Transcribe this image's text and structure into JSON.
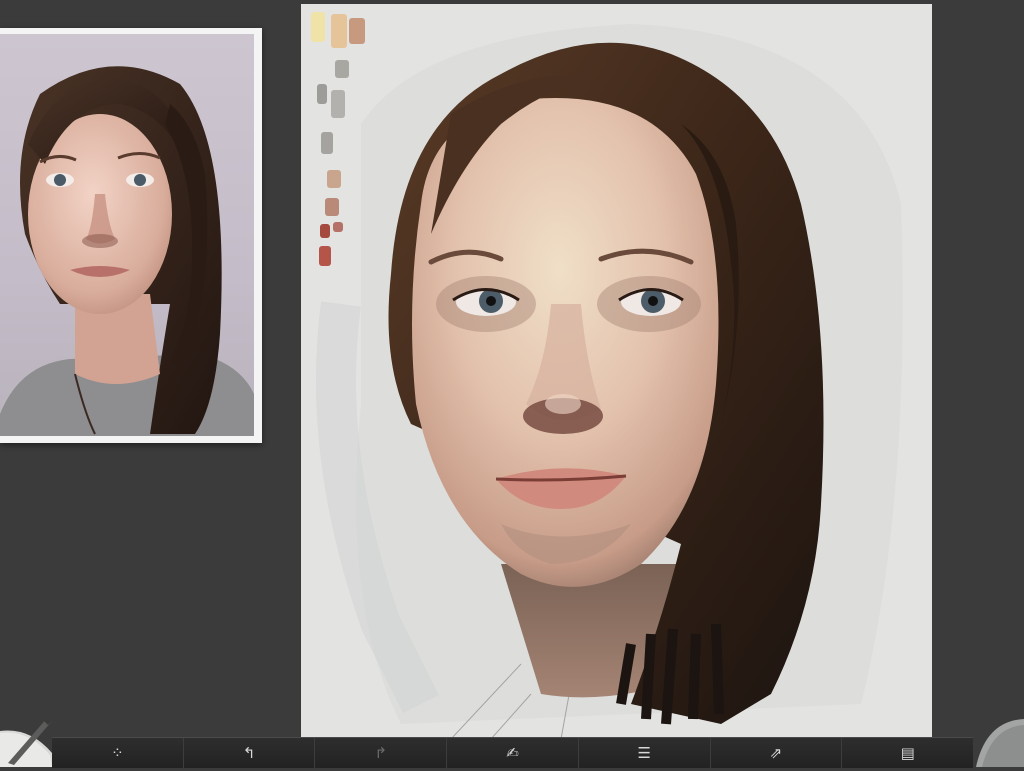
{
  "app": {
    "canvas_background": "#e3e3e1",
    "workspace_background": "#3b3b3b"
  },
  "palette": {
    "swatches": [
      "#efe3a8",
      "#e6c49a",
      "#c79a80",
      "#a9a7a2",
      "#9e9c98",
      "#b3b1ad",
      "#a5a3a0",
      "#c9a58e",
      "#b98a78",
      "#a54a3f",
      "#b57068",
      "#b5554a"
    ]
  },
  "toolbar": {
    "buttons": [
      {
        "name": "brush-settings-button",
        "icon": "dots-icon",
        "glyph": "⁘",
        "enabled": true
      },
      {
        "name": "undo-button",
        "icon": "undo-icon",
        "glyph": "↰",
        "enabled": true
      },
      {
        "name": "redo-button",
        "icon": "redo-icon",
        "glyph": "↱",
        "enabled": false
      },
      {
        "name": "reference-button",
        "icon": "figure-icon",
        "glyph": "✍",
        "enabled": true
      },
      {
        "name": "layers-button",
        "icon": "layers-icon",
        "glyph": "☰",
        "enabled": true
      },
      {
        "name": "export-button",
        "icon": "export-icon",
        "glyph": "⇗",
        "enabled": true
      },
      {
        "name": "gallery-button",
        "icon": "folder-icon",
        "glyph": "▤",
        "enabled": true
      }
    ]
  }
}
